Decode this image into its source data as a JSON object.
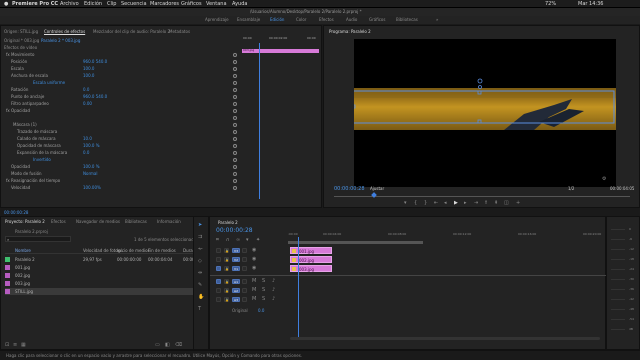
{
  "menubar": {
    "apple": "",
    "app": "Premiere Pro CC",
    "items": [
      "Archivo",
      "Edición",
      "Clip",
      "Secuencia",
      "Marcadores",
      "Gráficos",
      "Ventana",
      "Ayuda"
    ],
    "status": [
      "72%",
      "Mar 14:36"
    ]
  },
  "project_path": "/Usuarios/Alumno/Desktop/Paralelo 2/Paralelo 2.prproj *",
  "workspaces": [
    "Aprendizaje",
    "Ensamblaje",
    "Edición",
    "Color",
    "Efectos",
    "Audio",
    "Gráficos",
    "Bibliotecas"
  ],
  "workspace_active": "Edición",
  "effects": {
    "tabs": [
      "Origen: STILL.jpg",
      "Controles de efectos",
      "Mezclador del clip de audio: Paralelo 2",
      "Metadatos"
    ],
    "active_tab": "Controles de efectos",
    "source_label": "Original * 003.jpg",
    "seq_label": "Paralelo 2 * 003.jpg",
    "video_effects": "Efectos de vídeo",
    "clip_name": "003.jpg",
    "rows": [
      {
        "label": "fx  Movimiento",
        "value": "",
        "indent": 3
      },
      {
        "label": "Posición",
        "value": "960.0   540.0",
        "indent": 8
      },
      {
        "label": "Escala",
        "value": "100.0",
        "indent": 8
      },
      {
        "label": "Anchura de escala",
        "value": "100.0",
        "indent": 8
      },
      {
        "label": "",
        "value": "Escala uniforme",
        "indent": 24
      },
      {
        "label": "Rotación",
        "value": "0.0",
        "indent": 8
      },
      {
        "label": "Punto de anclaje",
        "value": "960.0   540.0",
        "indent": 8
      },
      {
        "label": "Filtro antiparpadeo",
        "value": "0.00",
        "indent": 8
      },
      {
        "label": "fx  Opacidad",
        "value": "",
        "indent": 3
      },
      {
        "label": "",
        "value": "",
        "indent": 10
      },
      {
        "label": "Máscara (1)",
        "value": "",
        "indent": 10
      },
      {
        "label": "Trazado de máscara",
        "value": "",
        "indent": 14
      },
      {
        "label": "Calado de máscara",
        "value": "10.0",
        "indent": 14
      },
      {
        "label": "Opacidad de máscara",
        "value": "100.0 %",
        "indent": 14
      },
      {
        "label": "Expansión de la máscara",
        "value": "0.0",
        "indent": 14
      },
      {
        "label": "",
        "value": "Invertido",
        "indent": 24
      },
      {
        "label": "Opacidad",
        "value": "100.0 %",
        "indent": 8
      },
      {
        "label": "Modo de fusión",
        "value": "Normal",
        "indent": 8
      },
      {
        "label": "fx  Reasignación del tiempo",
        "value": "",
        "indent": 3
      },
      {
        "label": "Velocidad",
        "value": "100.00%",
        "indent": 8
      }
    ],
    "time": "00:00:00:28",
    "mini_ruler": [
      "00:00",
      "00:00:02:00",
      "00:00"
    ],
    "mini_clip": "003.jpg"
  },
  "program": {
    "tab": "Programa: Paralelo 2",
    "timecode": "00:00:00:28",
    "fit": "Ajustar",
    "quality": "1/2",
    "duration": "00:00:04:05"
  },
  "project": {
    "tabs": [
      "Proyecto: Paralelo 2",
      "Efectos",
      "Navegador de medios",
      "Bibliotecas",
      "Información"
    ],
    "file": "Paralelo 2.prproj",
    "selection": "1 de 5 elementos seleccionados",
    "columns": [
      "Nombre",
      "Velocidad de fotogr.",
      "Inicio de medios",
      "Fin de medios",
      "Durac"
    ],
    "items": [
      {
        "name": "Paralelo 2",
        "fps": "29,97 fps",
        "start": "00:00:00:00",
        "end": "00:00:04:04",
        "dur": "00:00",
        "color": "#3fbf6f",
        "sel": false
      },
      {
        "name": "001.jpg",
        "fps": "",
        "start": "",
        "end": "",
        "dur": "",
        "color": "#b65cc0",
        "sel": false
      },
      {
        "name": "002.jpg",
        "fps": "",
        "start": "",
        "end": "",
        "dur": "",
        "color": "#b65cc0",
        "sel": false
      },
      {
        "name": "003.jpg",
        "fps": "",
        "start": "",
        "end": "",
        "dur": "",
        "color": "#b65cc0",
        "sel": false
      },
      {
        "name": "STILL.jpg",
        "fps": "",
        "start": "",
        "end": "",
        "dur": "",
        "color": "#b65cc0",
        "sel": true
      }
    ]
  },
  "timeline": {
    "tab": "Paralelo 2",
    "timecode": "00:00:00:28",
    "ruler": [
      ":00:00",
      "00:00:04:00",
      "00:00:08:00",
      "00:00:12:00",
      "00:00:16:00",
      "00:00:20:00"
    ],
    "video_tracks": [
      "V3",
      "V2",
      "V1"
    ],
    "audio_tracks": [
      "A1",
      "A2",
      "A3"
    ],
    "master": "Original",
    "master_val": "0.0",
    "clips": [
      {
        "name": "001.jpg",
        "track": "V3"
      },
      {
        "name": "002.jpg",
        "track": "V2"
      },
      {
        "name": "003.jpg",
        "track": "V1"
      }
    ]
  },
  "meter_scale": [
    "0",
    "-6",
    "-12",
    "-18",
    "-24",
    "-30",
    "-36",
    "-42",
    "-48",
    "-54",
    "dB"
  ],
  "statusbar": "Haga clic para seleccionar o clic en un espacio vacío y arrastre para seleccionar el recuadro. Utilice Mayús, Opción y Comando para otras opciones."
}
